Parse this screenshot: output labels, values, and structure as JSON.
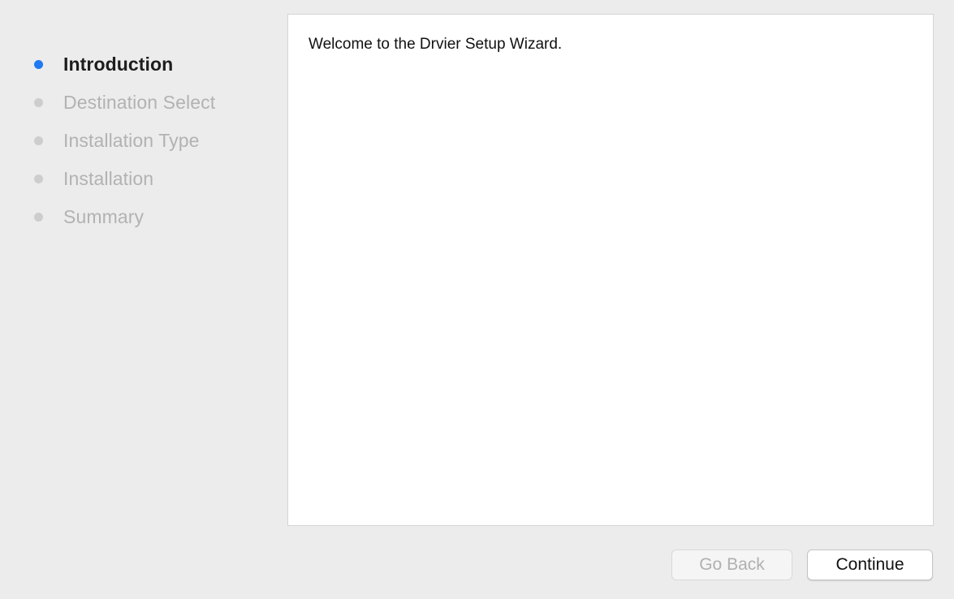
{
  "sidebar": {
    "steps": [
      {
        "label": "Introduction",
        "state": "active"
      },
      {
        "label": "Destination Select",
        "state": "pending"
      },
      {
        "label": "Installation Type",
        "state": "pending"
      },
      {
        "label": "Installation",
        "state": "pending"
      },
      {
        "label": "Summary",
        "state": "pending"
      }
    ]
  },
  "main": {
    "welcome_text": "Welcome to the Drvier Setup Wizard."
  },
  "footer": {
    "back_label": "Go Back",
    "back_enabled": false,
    "continue_label": "Continue",
    "continue_enabled": true
  },
  "colors": {
    "active_step_dot": "#1f79f0",
    "pending_step_dot": "#cdcdcd",
    "window_background": "#ececec",
    "content_background": "#ffffff"
  }
}
